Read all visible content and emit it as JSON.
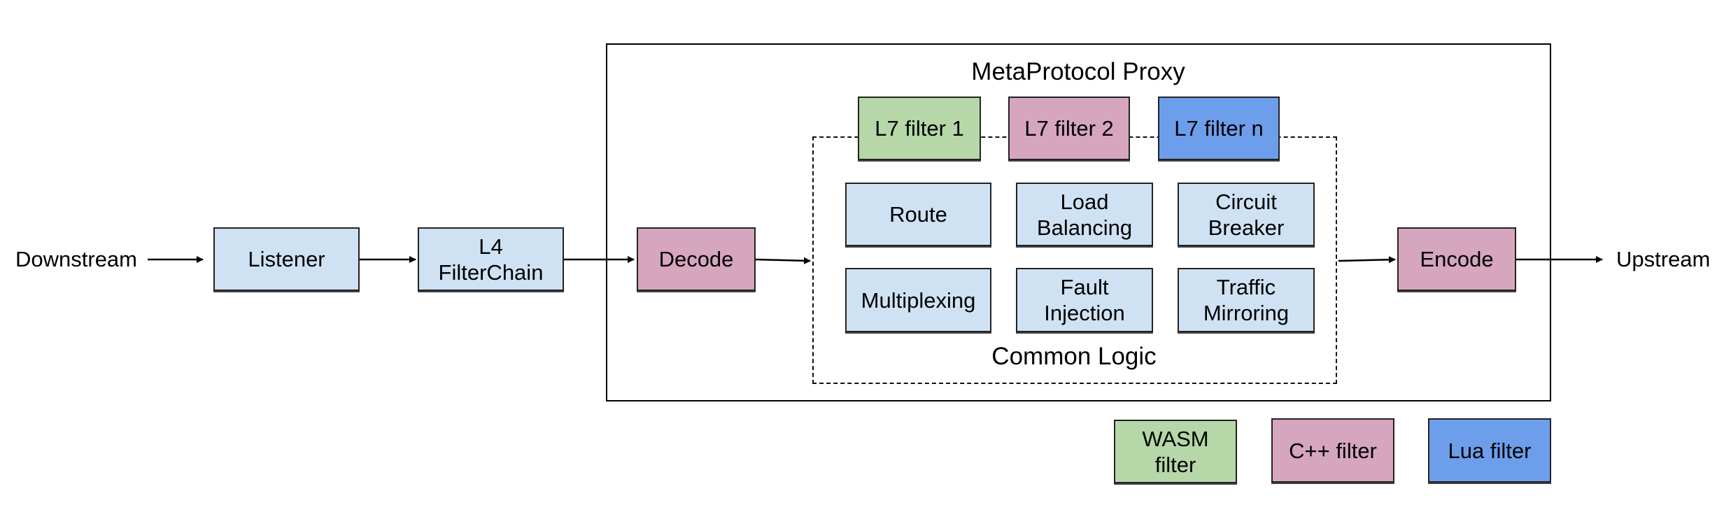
{
  "diagram": {
    "title": "MetaProtocol Proxy",
    "external": {
      "downstream": "Downstream",
      "upstream": "Upstream"
    },
    "pipeline": {
      "listener": "Listener",
      "l4_filterchain": "L4\nFilterChain",
      "decode": "Decode",
      "encode": "Encode"
    },
    "l7_filters": [
      {
        "label": "L7 filter 1",
        "kind": "wasm"
      },
      {
        "label": "L7 filter 2",
        "kind": "cpp"
      },
      {
        "label": "L7 filter n",
        "kind": "lua"
      }
    ],
    "common_logic": {
      "label": "Common Logic",
      "modules": [
        "Route",
        "Load\nBalancing",
        "Circuit\nBreaker",
        "Multiplexing",
        "Fault\nInjection",
        "Traffic\nMirroring"
      ]
    },
    "legend": [
      {
        "label": "WASM\nfilter",
        "color": "#b6d7a8"
      },
      {
        "label": "C++ filter",
        "color": "#d5a6bd"
      },
      {
        "label": "Lua filter",
        "color": "#6d9eeb"
      }
    ],
    "colors": {
      "core_component": "#cfe2f3",
      "codec": "#d5a6bd",
      "wasm": "#b6d7a8",
      "cpp": "#d5a6bd",
      "lua": "#6d9eeb"
    },
    "flow": [
      "Downstream",
      "Listener",
      "L4 FilterChain",
      "Decode",
      "Common Logic",
      "Encode",
      "Upstream"
    ]
  }
}
